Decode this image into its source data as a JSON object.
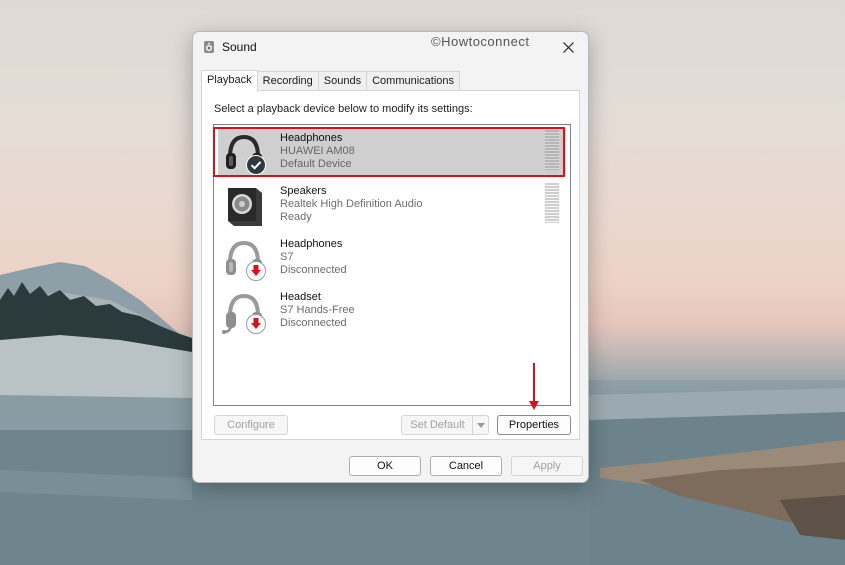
{
  "window": {
    "title": "Sound",
    "watermark": "©Howtoconnect"
  },
  "tabs": [
    {
      "label": "Playback",
      "active": true
    },
    {
      "label": "Recording",
      "active": false
    },
    {
      "label": "Sounds",
      "active": false
    },
    {
      "label": "Communications",
      "active": false
    }
  ],
  "playback": {
    "instruction": "Select a playback device below to modify its settings:",
    "devices": [
      {
        "name": "Headphones",
        "model": "HUAWEI AM08",
        "status": "Default Device",
        "icon": "headphones-icon",
        "badge": "check",
        "selected": true
      },
      {
        "name": "Speakers",
        "model": "Realtek High Definition Audio",
        "status": "Ready",
        "icon": "speaker-icon",
        "badge": "none",
        "selected": false
      },
      {
        "name": "Headphones",
        "model": "S7",
        "status": "Disconnected",
        "icon": "headphones-icon",
        "badge": "disconnected-arrow",
        "selected": false
      },
      {
        "name": "Headset",
        "model": "S7 Hands-Free",
        "status": "Disconnected",
        "icon": "headset-icon",
        "badge": "disconnected-arrow",
        "selected": false
      }
    ],
    "configure_label": "Configure",
    "set_default_label": "Set Default",
    "properties_label": "Properties"
  },
  "footer": {
    "ok_label": "OK",
    "cancel_label": "Cancel",
    "apply_label": "Apply"
  },
  "colors": {
    "highlight": "#d8121a",
    "selected_row": "#cfcfcf",
    "badge_check": "#2f3a40",
    "badge_arrow": "#d8121a"
  }
}
